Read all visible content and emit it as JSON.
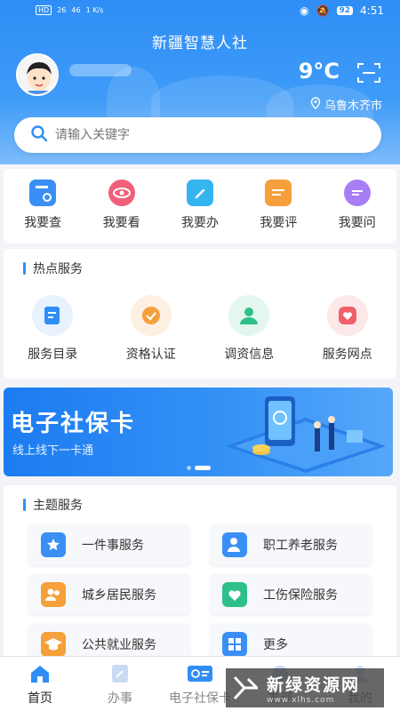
{
  "status_bar": {
    "left_badges": [
      "HD",
      "26",
      "46",
      "1 K/s"
    ],
    "battery": "92",
    "time": "4:51"
  },
  "header": {
    "title": "新疆智慧人社",
    "temperature": "9°C",
    "location": "乌鲁木齐市"
  },
  "search": {
    "placeholder": "请输入关键字"
  },
  "quick_actions": [
    {
      "label": "我要查",
      "icon": "search-doc-icon",
      "color": "#3a8ff5"
    },
    {
      "label": "我要看",
      "icon": "eye-icon",
      "color": "#f0607a"
    },
    {
      "label": "我要办",
      "icon": "folder-pen-icon",
      "color": "#35b5f0"
    },
    {
      "label": "我要评",
      "icon": "comment-icon",
      "color": "#f5a03a"
    },
    {
      "label": "我要问",
      "icon": "chat-icon",
      "color": "#a97ef5"
    }
  ],
  "hot_services": {
    "title": "热点服务",
    "items": [
      {
        "label": "服务目录",
        "icon": "catalog-icon",
        "color": "#2f8ef6",
        "bg": "#e8f2fe"
      },
      {
        "label": "资格认证",
        "icon": "check-badge-icon",
        "color": "#f5a03a",
        "bg": "#fdf0e2"
      },
      {
        "label": "调资信息",
        "icon": "person-icon",
        "color": "#2ec08a",
        "bg": "#e3f7ef"
      },
      {
        "label": "服务网点",
        "icon": "heart-pin-icon",
        "color": "#f0606a",
        "bg": "#fde8e9"
      }
    ]
  },
  "banner": {
    "title": "电子社保卡",
    "subtitle": "线上线下一卡通"
  },
  "theme_services": {
    "title": "主题服务",
    "items": [
      {
        "label": "一件事服务",
        "icon": "star-badge-icon",
        "color": "#3a8ff5"
      },
      {
        "label": "职工养老服务",
        "icon": "elder-icon",
        "color": "#3a8ff5"
      },
      {
        "label": "城乡居民服务",
        "icon": "people-icon",
        "color": "#f5a03a"
      },
      {
        "label": "工伤保险服务",
        "icon": "heart-icon",
        "color": "#2ec08a"
      },
      {
        "label": "公共就业服务",
        "icon": "graduation-icon",
        "color": "#f5a03a"
      },
      {
        "label": "更多",
        "icon": "grid-icon",
        "color": "#3a8ff5"
      }
    ]
  },
  "tabbar": [
    {
      "label": "首页",
      "icon": "home-icon",
      "active": true
    },
    {
      "label": "办事",
      "icon": "pen-icon",
      "active": false
    },
    {
      "label": "电子社保卡",
      "icon": "card-icon",
      "active": false
    },
    {
      "label": "发现",
      "icon": "compass-icon",
      "active": false
    },
    {
      "label": "我的",
      "icon": "user-icon",
      "active": false
    }
  ],
  "watermark": {
    "main": "新绿资源网",
    "url": "www.xlhs.com"
  }
}
